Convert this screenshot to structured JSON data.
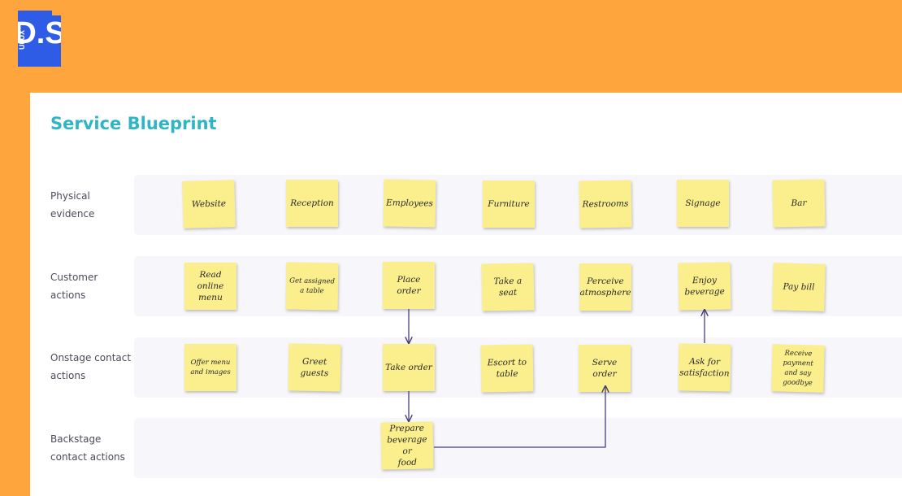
{
  "brand": {
    "logo_text": "UI UX",
    "logo_letters": "D.S",
    "colors": {
      "background": "#ffa53e",
      "logo": "#2f5ce6",
      "title": "#2fb5c4",
      "sticky": "#fbee8c",
      "arrow": "#44407a"
    }
  },
  "board": {
    "title": "Service Blueprint",
    "lanes": [
      {
        "label": "Physical\nevidence",
        "notes": [
          "Website",
          "Reception",
          "Employees",
          "Furniture",
          "Restrooms",
          "Signage",
          "Bar"
        ]
      },
      {
        "label": "Customer\nactions",
        "notes": [
          "Read online\nmenu",
          "Get assigned\na table",
          "Place order",
          "Take a\nseat",
          "Perceive\natmosphere",
          "Enjoy\nbeverage",
          "Pay bill"
        ]
      },
      {
        "label": "Onstage contact\nactions",
        "notes": [
          "Offer menu\nand images",
          "Greet\nguests",
          "Take order",
          "Escort to\ntable",
          "Serve\norder",
          "Ask for\nsatisfaction",
          "Receive payment\nand say goodbye"
        ]
      },
      {
        "label": "Backstage\ncontact actions",
        "notes": [
          "Prepare\nbeverage or\nfood"
        ]
      }
    ]
  }
}
